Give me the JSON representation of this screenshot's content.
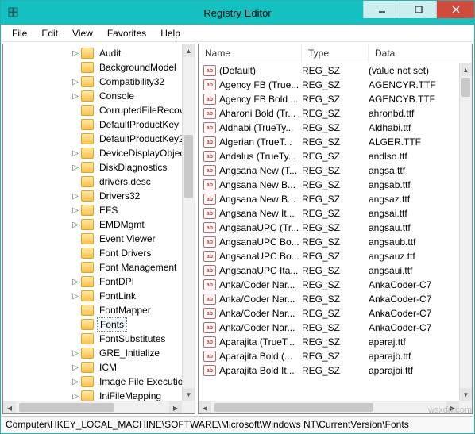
{
  "window": {
    "title": "Registry Editor"
  },
  "menu": {
    "file": "File",
    "edit": "Edit",
    "view": "View",
    "favorites": "Favorites",
    "help": "Help"
  },
  "tree": {
    "items": [
      {
        "label": "Audit",
        "expandable": true
      },
      {
        "label": "BackgroundModel",
        "expandable": false
      },
      {
        "label": "Compatibility32",
        "expandable": true
      },
      {
        "label": "Console",
        "expandable": true
      },
      {
        "label": "CorruptedFileRecov",
        "expandable": false
      },
      {
        "label": "DefaultProductKey",
        "expandable": false
      },
      {
        "label": "DefaultProductKey2",
        "expandable": false
      },
      {
        "label": "DeviceDisplayObjec",
        "expandable": true
      },
      {
        "label": "DiskDiagnostics",
        "expandable": true
      },
      {
        "label": "drivers.desc",
        "expandable": false
      },
      {
        "label": "Drivers32",
        "expandable": true
      },
      {
        "label": "EFS",
        "expandable": true
      },
      {
        "label": "EMDMgmt",
        "expandable": true
      },
      {
        "label": "Event Viewer",
        "expandable": false
      },
      {
        "label": "Font Drivers",
        "expandable": false
      },
      {
        "label": "Font Management",
        "expandable": false
      },
      {
        "label": "FontDPI",
        "expandable": true
      },
      {
        "label": "FontLink",
        "expandable": true
      },
      {
        "label": "FontMapper",
        "expandable": false
      },
      {
        "label": "Fonts",
        "expandable": false,
        "selected": true
      },
      {
        "label": "FontSubstitutes",
        "expandable": false
      },
      {
        "label": "GRE_Initialize",
        "expandable": true
      },
      {
        "label": "ICM",
        "expandable": true
      },
      {
        "label": "Image File Execution",
        "expandable": true
      },
      {
        "label": "IniFileMapping",
        "expandable": true
      }
    ]
  },
  "list": {
    "headers": {
      "name": "Name",
      "type": "Type",
      "data": "Data"
    },
    "rows": [
      {
        "name": "(Default)",
        "type": "REG_SZ",
        "data": "(value not set)"
      },
      {
        "name": "Agency FB (True...",
        "type": "REG_SZ",
        "data": "AGENCYR.TTF"
      },
      {
        "name": "Agency FB Bold ...",
        "type": "REG_SZ",
        "data": "AGENCYB.TTF"
      },
      {
        "name": "Aharoni Bold (Tr...",
        "type": "REG_SZ",
        "data": "ahronbd.ttf"
      },
      {
        "name": "Aldhabi (TrueTy...",
        "type": "REG_SZ",
        "data": "Aldhabi.ttf"
      },
      {
        "name": "Algerian (TrueT...",
        "type": "REG_SZ",
        "data": "ALGER.TTF"
      },
      {
        "name": "Andalus (TrueTy...",
        "type": "REG_SZ",
        "data": "andlso.ttf"
      },
      {
        "name": "Angsana New (T...",
        "type": "REG_SZ",
        "data": "angsa.ttf"
      },
      {
        "name": "Angsana New B...",
        "type": "REG_SZ",
        "data": "angsab.ttf"
      },
      {
        "name": "Angsana New B...",
        "type": "REG_SZ",
        "data": "angsaz.ttf"
      },
      {
        "name": "Angsana New It...",
        "type": "REG_SZ",
        "data": "angsai.ttf"
      },
      {
        "name": "AngsanaUPC (Tr...",
        "type": "REG_SZ",
        "data": "angsau.ttf"
      },
      {
        "name": "AngsanaUPC Bo...",
        "type": "REG_SZ",
        "data": "angsaub.ttf"
      },
      {
        "name": "AngsanaUPC Bo...",
        "type": "REG_SZ",
        "data": "angsauz.ttf"
      },
      {
        "name": "AngsanaUPC Ita...",
        "type": "REG_SZ",
        "data": "angsaui.ttf"
      },
      {
        "name": "Anka/Coder Nar...",
        "type": "REG_SZ",
        "data": "AnkaCoder-C7"
      },
      {
        "name": "Anka/Coder Nar...",
        "type": "REG_SZ",
        "data": "AnkaCoder-C7"
      },
      {
        "name": "Anka/Coder Nar...",
        "type": "REG_SZ",
        "data": "AnkaCoder-C7"
      },
      {
        "name": "Anka/Coder Nar...",
        "type": "REG_SZ",
        "data": "AnkaCoder-C7"
      },
      {
        "name": "Aparajita (TrueT...",
        "type": "REG_SZ",
        "data": "aparaj.ttf"
      },
      {
        "name": "Aparajita Bold (...",
        "type": "REG_SZ",
        "data": "aparajb.ttf"
      },
      {
        "name": "Aparajita Bold It...",
        "type": "REG_SZ",
        "data": "aparajbi.ttf"
      }
    ]
  },
  "status": {
    "path": "Computer\\HKEY_LOCAL_MACHINE\\SOFTWARE\\Microsoft\\Windows NT\\CurrentVersion\\Fonts"
  },
  "watermark": "wsxdn.com"
}
